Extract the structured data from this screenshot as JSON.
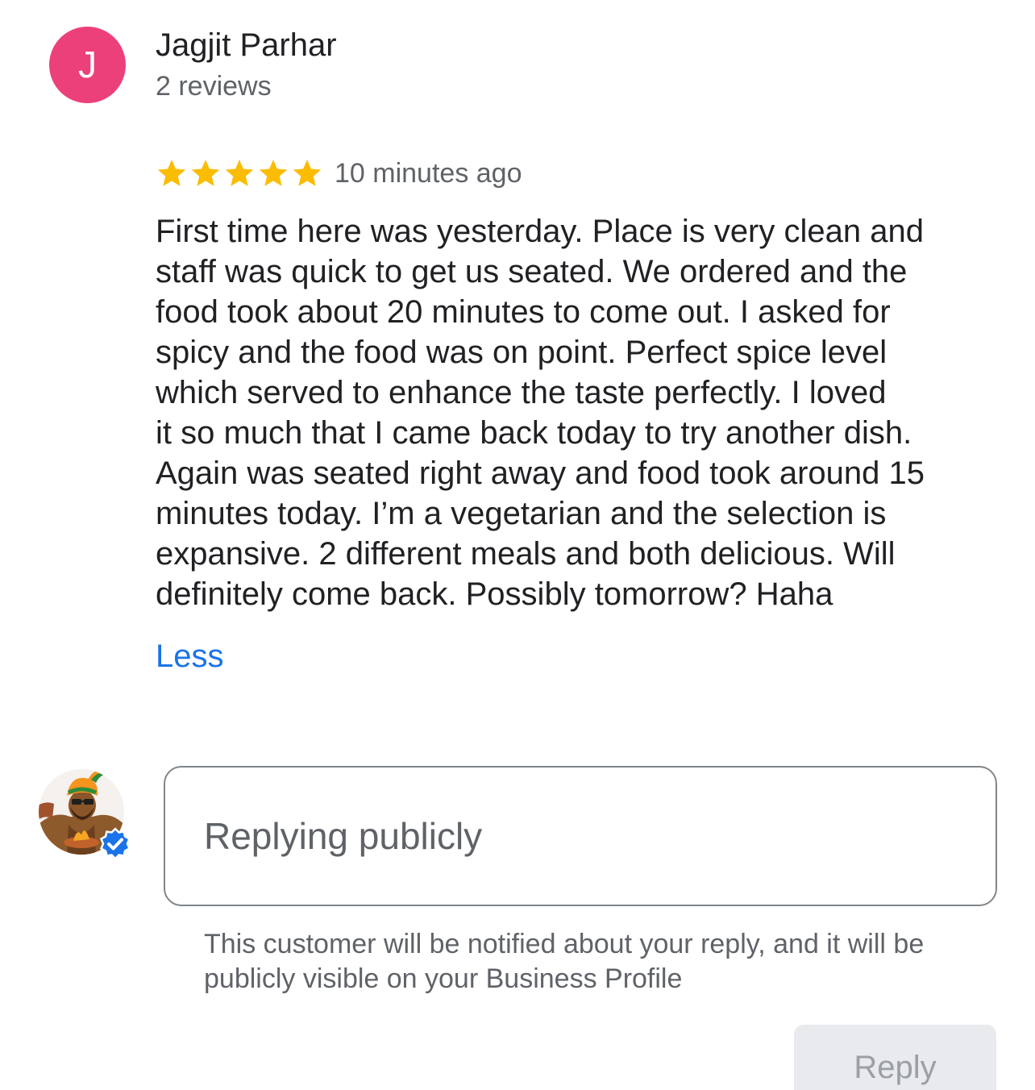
{
  "reviewer": {
    "initial": "J",
    "name": "Jagjit Parhar",
    "review_count": "2 reviews",
    "avatar_color": "#ec407a"
  },
  "review": {
    "rating": 5,
    "max_rating": 5,
    "star_color": "#fbbc04",
    "time_ago": "10 minutes ago",
    "lines": [
      "First time here was yesterday. Place is very clean and",
      "staff was quick to get us seated. We ordered and the",
      "food took about 20 minutes to come out. I asked for",
      "spicy and the food was on point. Perfect spice level",
      "which served to enhance the taste perfectly. I loved",
      "it so much that I came back today to try another dish.",
      "Again was seated right away and food took around 15",
      "minutes today. I’m a vegetarian and the selection is",
      "expansive. 2 different meals and both delicious. Will",
      "definitely come back. Possibly tomorrow? Haha"
    ],
    "less_label": "Less",
    "link_color": "#1a73e8"
  },
  "reply": {
    "owner_avatar_icon": "business-logo-avatar",
    "verified_icon": "verified-check-icon",
    "verified_color": "#1a73e8",
    "placeholder": "Replying publicly",
    "value": "",
    "notice": "This customer will be notified about your reply, and it will be publicly visible on your Business Profile",
    "button_label": "Reply"
  }
}
